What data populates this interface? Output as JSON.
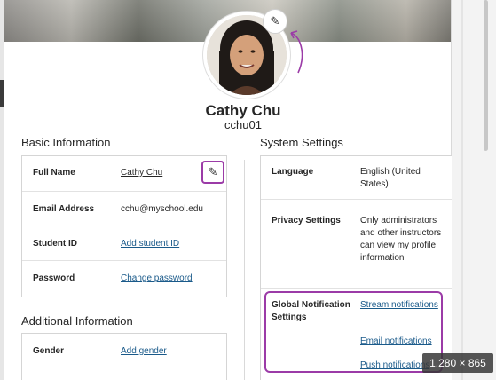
{
  "profile": {
    "name": "Cathy Chu",
    "username": "cchu01",
    "edit_avatar_icon": "pencil-icon"
  },
  "basic_info": {
    "title": "Basic Information",
    "rows": [
      {
        "label": "Full Name",
        "value": "Cathy Chu"
      },
      {
        "label": "Email Address",
        "value": "cchu@myschool.edu"
      },
      {
        "label": "Student ID",
        "value": "Add student ID"
      },
      {
        "label": "Password",
        "value": "Change password"
      }
    ],
    "edit_icon": "pencil-icon"
  },
  "additional_info": {
    "title": "Additional Information",
    "rows": [
      {
        "label": "Gender",
        "value": "Add gender"
      }
    ]
  },
  "system_settings": {
    "title": "System Settings",
    "language": {
      "label": "Language",
      "value": "English (United States)"
    },
    "privacy": {
      "label": "Privacy Settings",
      "value": "Only administrators and other instructors can view my profile information"
    },
    "notifications": {
      "label": "Global Notification Settings",
      "links": [
        "Stream notifications",
        "Email notifications",
        "Push notifications"
      ]
    }
  },
  "image_badge": "1,280 × 865",
  "colors": {
    "highlight": "#9b3ba7",
    "link": "#1a5a8a"
  }
}
